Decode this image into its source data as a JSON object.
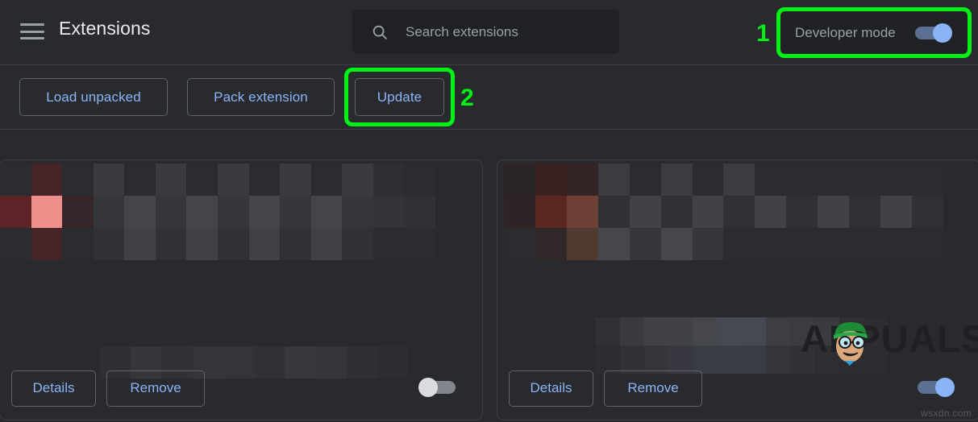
{
  "header": {
    "menu_icon": "hamburger-menu-icon",
    "title": "Extensions",
    "search": {
      "icon": "search-icon",
      "placeholder": "Search extensions",
      "value": ""
    },
    "developer_mode": {
      "label": "Developer mode",
      "enabled": true,
      "toggle_state": "on"
    }
  },
  "toolbar": {
    "load_unpacked_label": "Load unpacked",
    "pack_extension_label": "Pack extension",
    "update_label": "Update"
  },
  "annotations": [
    {
      "number": "1",
      "target": "developer-mode-toggle",
      "color": "#00f215"
    },
    {
      "number": "2",
      "target": "update-button",
      "color": "#00f215"
    }
  ],
  "colors": {
    "background": "#292a2d",
    "surface": "#202124",
    "border": "#3c4043",
    "accent_blue": "#8ab4f8",
    "text_primary": "#e8eaed",
    "text_secondary": "#9aa0a6",
    "highlight_green": "#00f215",
    "toggle_on_track": "#5b6f92",
    "toggle_off_track": "#80868b",
    "toggle_off_knob": "#dadce0"
  },
  "extension_cards": [
    {
      "name": "extension-card-1",
      "title_censored": true,
      "description_censored": true,
      "details_label": "Details",
      "remove_label": "Remove",
      "toggle_state": "off",
      "enabled": false
    },
    {
      "name": "extension-card-2",
      "title_censored": true,
      "description_censored": true,
      "details_label": "Details",
      "remove_label": "Remove",
      "toggle_state": "on",
      "enabled": true
    }
  ],
  "watermarks": {
    "brand": "APPUALS",
    "site": "wsxdn.com"
  }
}
